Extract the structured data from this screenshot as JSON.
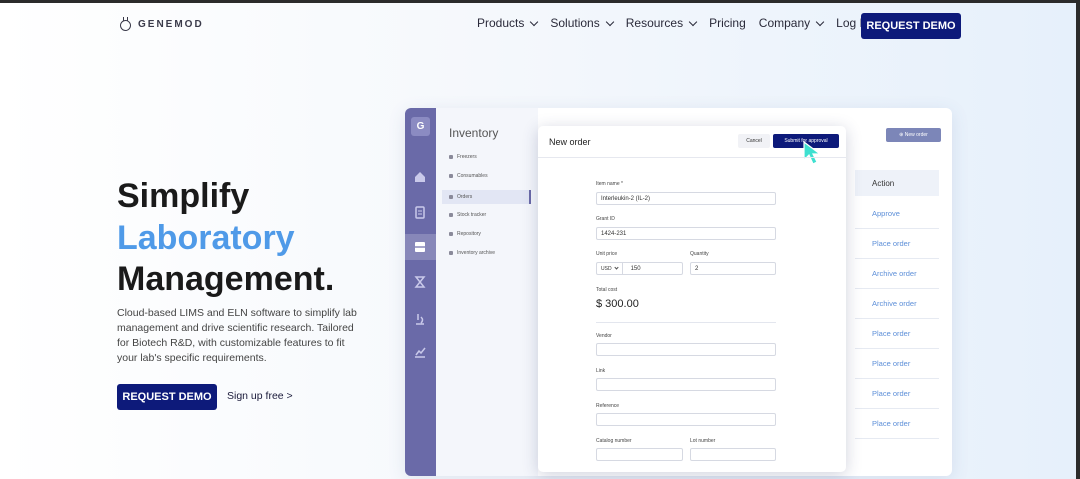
{
  "nav": {
    "logo_text": "GENEMOD",
    "items": [
      "Products",
      "Solutions",
      "Resources",
      "Pricing",
      "Company",
      "Log In"
    ],
    "items_with_chevron": [
      true,
      true,
      true,
      false,
      true,
      false
    ],
    "cta": "REQUEST DEMO"
  },
  "hero": {
    "line1": "Simplify",
    "line2": "Laboratory",
    "line3": "Management.",
    "description": "Cloud-based LIMS and ELN software to simplify lab management and drive scientific research. Tailored for Biotech R&D, with customizable features to fit your lab's specific requirements.",
    "cta": "REQUEST DEMO",
    "signup": "Sign up free >"
  },
  "app": {
    "rail_logo": "G",
    "panel_title": "Inventory",
    "side_items": [
      "Freezers",
      "Consumables",
      "Orders",
      "Stock tracker",
      "Repository",
      "Inventory archive"
    ],
    "selected_side_item": "Orders",
    "new_order_button": "New order",
    "table": {
      "header": "Action",
      "rows": [
        "Approve",
        "Place order",
        "Archive order",
        "Archive order",
        "Place order",
        "Place order",
        "Place order",
        "Place order"
      ]
    }
  },
  "modal": {
    "title": "New order",
    "cancel": "Cancel",
    "submit": "Submit for approval",
    "item_name_label": "Item name *",
    "item_name_value": "Interleukin-2 (IL-2)",
    "grant_id_label": "Grant ID",
    "grant_id_value": "1424-231",
    "unit_price_label": "Unit price",
    "currency": "USD",
    "unit_price_value": "150",
    "quantity_label": "Quantity",
    "quantity_value": "2",
    "total_cost_label": "Total cost",
    "total_cost_value": "$ 300.00",
    "vendor_label": "Vendor",
    "link_label": "Link",
    "reference_label": "Reference",
    "catalog_label": "Catalog number",
    "lot_label": "Lot number"
  },
  "colors": {
    "brand_navy": "#0d1a7a",
    "accent_blue": "#4f9ae8",
    "rail": "#6a6aa8",
    "cursor": "#3ee0d0"
  }
}
